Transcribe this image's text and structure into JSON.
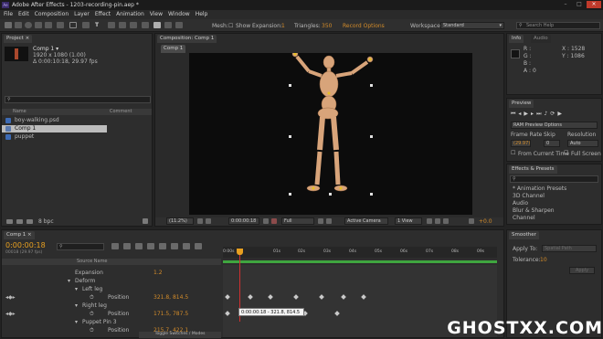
{
  "title_bar": {
    "title": "Adobe After Effects - 1203-recording-pin.aep *"
  },
  "menu": [
    "File",
    "Edit",
    "Composition",
    "Layer",
    "Effect",
    "Animation",
    "View",
    "Window",
    "Help"
  ],
  "toolbar": {
    "mesh_label": "Mesh:",
    "show_label": "Show",
    "expansion_label": "Expansion:",
    "expansion_value": "1",
    "triangles_label": "Triangles:",
    "triangles_value": "350",
    "record_options": "Record Options",
    "workspace_label": "Workspace:",
    "workspace_value": "Standard",
    "search_placeholder": "Search Help"
  },
  "project": {
    "tab": "Project ×",
    "comp_name": "Comp 1 ▾",
    "comp_size": "1920 x 1080 (1.00)",
    "comp_duration": "Δ 0:00:10:18, 29.97 fps",
    "col_name": "Name",
    "col_comment": "Comment",
    "items": [
      "boy-walking.psd",
      "Comp 1",
      "puppet"
    ],
    "bpc": "8 bpc"
  },
  "composition": {
    "tab": "Composition: Comp 1",
    "subtab": "Comp 1",
    "zoom": "(11.2%)",
    "timecode": "0:00:00:18",
    "resolution": "Full",
    "camera": "Active Camera",
    "views": "1 View",
    "exposure": "+0.0"
  },
  "info": {
    "tab": "Info",
    "tab2": "Audio",
    "r": "R :",
    "g": "G :",
    "b": "B :",
    "a": "A : 0",
    "x": "X : 1528",
    "y": "Y : 1086"
  },
  "preview": {
    "tab": "Preview",
    "ram_options": "RAM Preview Options",
    "frame_rate_label": "Frame Rate",
    "skip_label": "Skip",
    "resolution_label": "Resolution",
    "frame_rate_value": "(29.97)",
    "skip_value": "0",
    "resolution_value": "Auto",
    "from_current": "From Current Time",
    "full_screen": "Full Screen"
  },
  "effects": {
    "tab": "Effects & Presets",
    "items": [
      "* Animation Presets",
      "3D Channel",
      "Audio",
      "Blur & Sharpen",
      "Channel"
    ]
  },
  "smoother": {
    "tab": "Smoother",
    "apply_label": "Apply To:",
    "apply_value": "Spatial Path",
    "tolerance_label": "Tolerance:",
    "tolerance_value": "10",
    "apply_button": "Apply"
  },
  "timeline": {
    "tab": "Comp 1 ×",
    "timecode": "0:00:00:18",
    "fps_line": "00018 (29.97 fps)",
    "source_col": "Source Name",
    "ruler": [
      "0:00s",
      "01s",
      "02s",
      "03s",
      "04s",
      "05s",
      "06s",
      "07s",
      "08s",
      "09s",
      "10s"
    ],
    "layers": [
      {
        "name": "Expansion",
        "value": "1.2"
      },
      {
        "name": "Deform",
        "value": ""
      },
      {
        "name": "Left leg",
        "value": ""
      },
      {
        "name": "Position",
        "value": "321.8, 814.5"
      },
      {
        "name": "Right leg",
        "value": ""
      },
      {
        "name": "Position",
        "value": "171.5, 787.5"
      },
      {
        "name": "Puppet Pin 3",
        "value": ""
      },
      {
        "name": "Position",
        "value": "215.7, 422.1"
      }
    ],
    "tooltip": "0:00:00:18 - 321.8, 814.5",
    "toggle_label": "Toggle Switches / Modes"
  },
  "watermark": "GHOSTXX.COM",
  "colors": {
    "accent": "#d28b2a",
    "timeline_green": "#3fa63f",
    "ae_purple": "#3b2c6b",
    "cti_orange": "#e8a020"
  }
}
